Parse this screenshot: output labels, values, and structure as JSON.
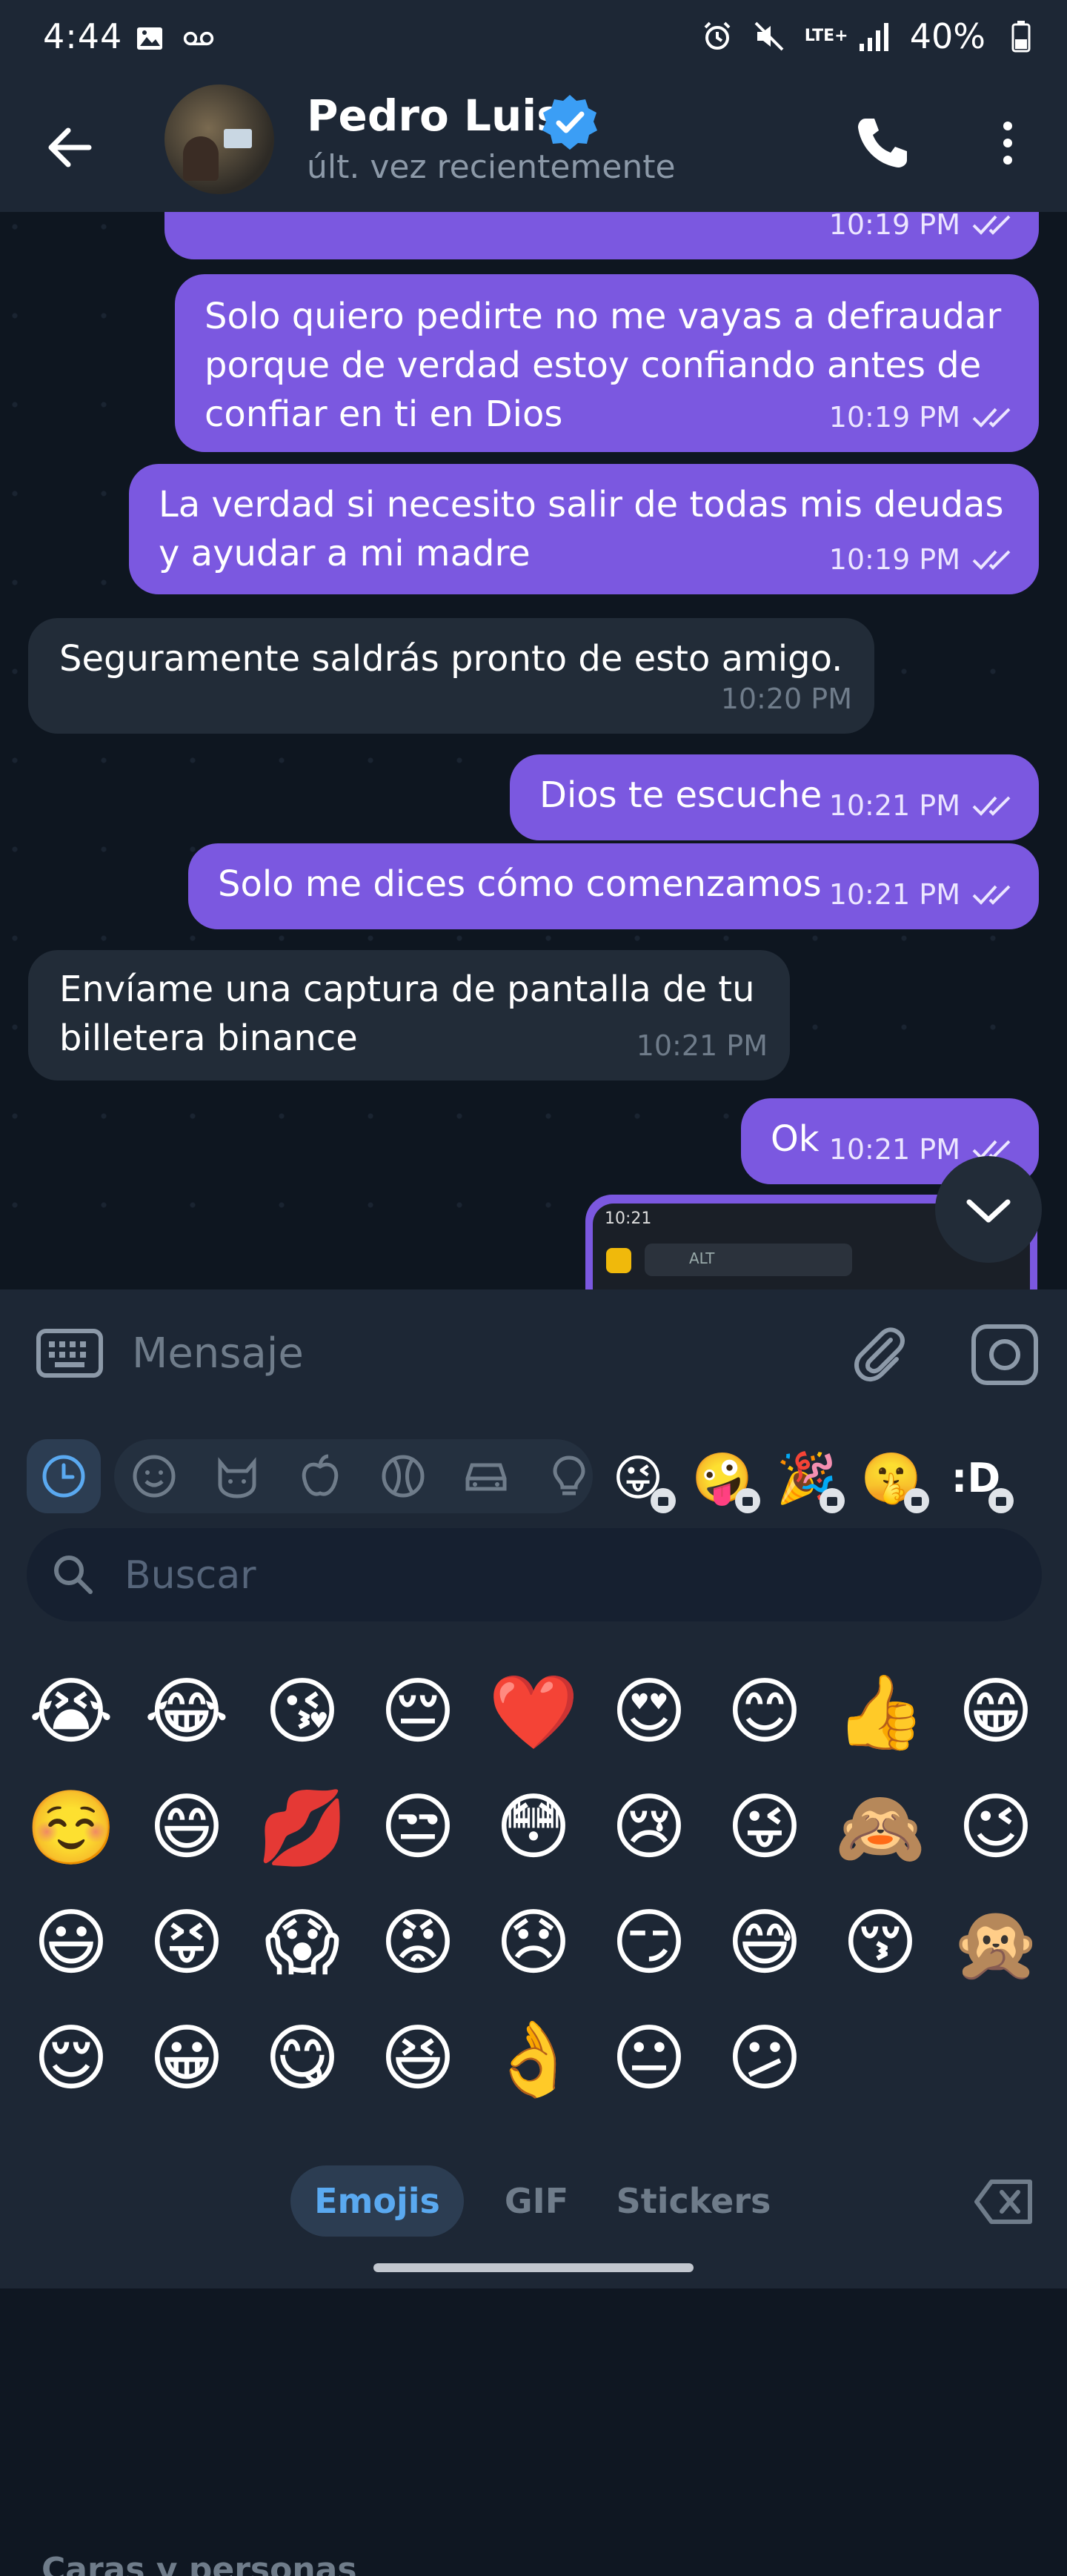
{
  "status_bar": {
    "time": "4:44",
    "battery": "40%",
    "network": "LTE+"
  },
  "header": {
    "contact_name": "Pedro Luis",
    "contact_status": "últ. vez recientemente"
  },
  "messages": [
    {
      "direction": "out",
      "text": "",
      "time": "10:19 PM"
    },
    {
      "direction": "out",
      "text": "Solo quiero pedirte no me vayas a defraudar porque de verdad estoy confiando antes de confiar en ti en Dios",
      "time": "10:19 PM"
    },
    {
      "direction": "out",
      "text": "La verdad si necesito salir de todas mis deudas y ayudar a mi madre",
      "time": "10:19 PM"
    },
    {
      "direction": "in",
      "text": "Seguramente saldrás pronto de esto amigo.",
      "time": "10:20 PM"
    },
    {
      "direction": "out",
      "text": "Dios te escuche",
      "time": "10:21 PM"
    },
    {
      "direction": "out",
      "text": "Solo me dices cómo comenzamos",
      "time": "10:21 PM"
    },
    {
      "direction": "in",
      "text": "Envíame una captura de pantalla de tu billetera binance",
      "time": "10:21 PM"
    },
    {
      "direction": "out",
      "text": "Ok",
      "time": "10:21 PM"
    }
  ],
  "screenshot_preview": {
    "time": "10:21",
    "search_text": "ALT"
  },
  "composer": {
    "placeholder": "Mensaje"
  },
  "emoji_panel": {
    "search_placeholder": "Buscar",
    "categories": [
      "recent-icon",
      "smiley-icon",
      "cat-icon",
      "apple-icon",
      "ball-icon",
      "car-icon",
      "bulb-icon"
    ],
    "premium_packs": [
      "😜",
      "🤪",
      "🎉",
      "🤫",
      ":D"
    ],
    "emojis": [
      "😭",
      "😂",
      "😘",
      "😔",
      "❤️",
      "😍",
      "😊",
      "👍",
      "😁",
      "☺️",
      "😄",
      "💋",
      "😒",
      "😳",
      "😢",
      "😜",
      "🙈",
      "😉",
      "😃",
      "😝",
      "😱",
      "😡",
      "😞",
      "😏",
      "😅",
      "😚",
      "🙊",
      "😌",
      "😀",
      "😋",
      "😆",
      "👌",
      "😐",
      "😕"
    ],
    "section_label": "Caras y personas",
    "tabs": {
      "emojis": "Emojis",
      "gif": "GIF",
      "stickers": "Stickers"
    }
  },
  "colors": {
    "outgoing_bubble": "#7b58e0",
    "incoming_bubble": "#222c38",
    "accent": "#5aa9f0"
  }
}
